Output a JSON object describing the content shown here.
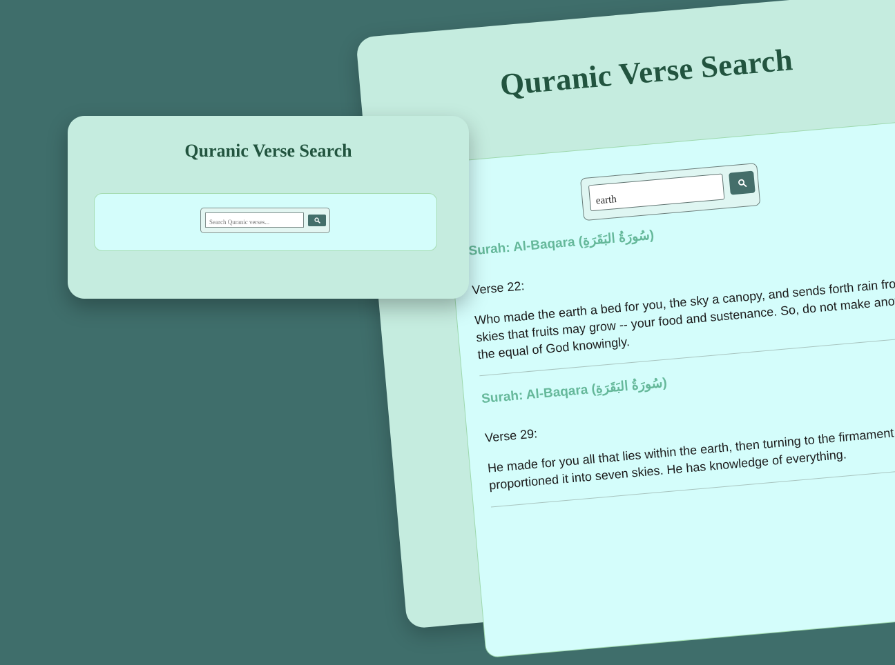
{
  "back_panel": {
    "title": "Quranic Verse Search",
    "search": {
      "value": "earth",
      "button_icon": "search-icon"
    },
    "results": [
      {
        "surah": "Surah: Al-Baqara (سُورَةُ البَقَرَةِ)",
        "verse_label": "Verse 22:",
        "text": "Who made the earth a bed for you, the sky a canopy, and sends forth rain from the skies that fruits may grow -- your food and sustenance. So, do not make another the equal of God knowingly."
      },
      {
        "surah": "Surah: Al-Baqara (سُورَةُ البَقَرَةِ)",
        "verse_label": "Verse 29:",
        "text": "He made for you all that lies within the earth, then turning to the firmament He proportioned it into seven skies. He has knowledge of everything."
      }
    ]
  },
  "front_card": {
    "title": "Quranic Verse Search",
    "search": {
      "placeholder": "Search Quranic verses...",
      "button_icon": "search-icon"
    }
  },
  "colors": {
    "background": "#3f6e6b",
    "card": "#c5ecdf",
    "inner": "#d4fdfb",
    "title": "#22543f",
    "surah": "#65b89a",
    "button": "#446e6a"
  }
}
